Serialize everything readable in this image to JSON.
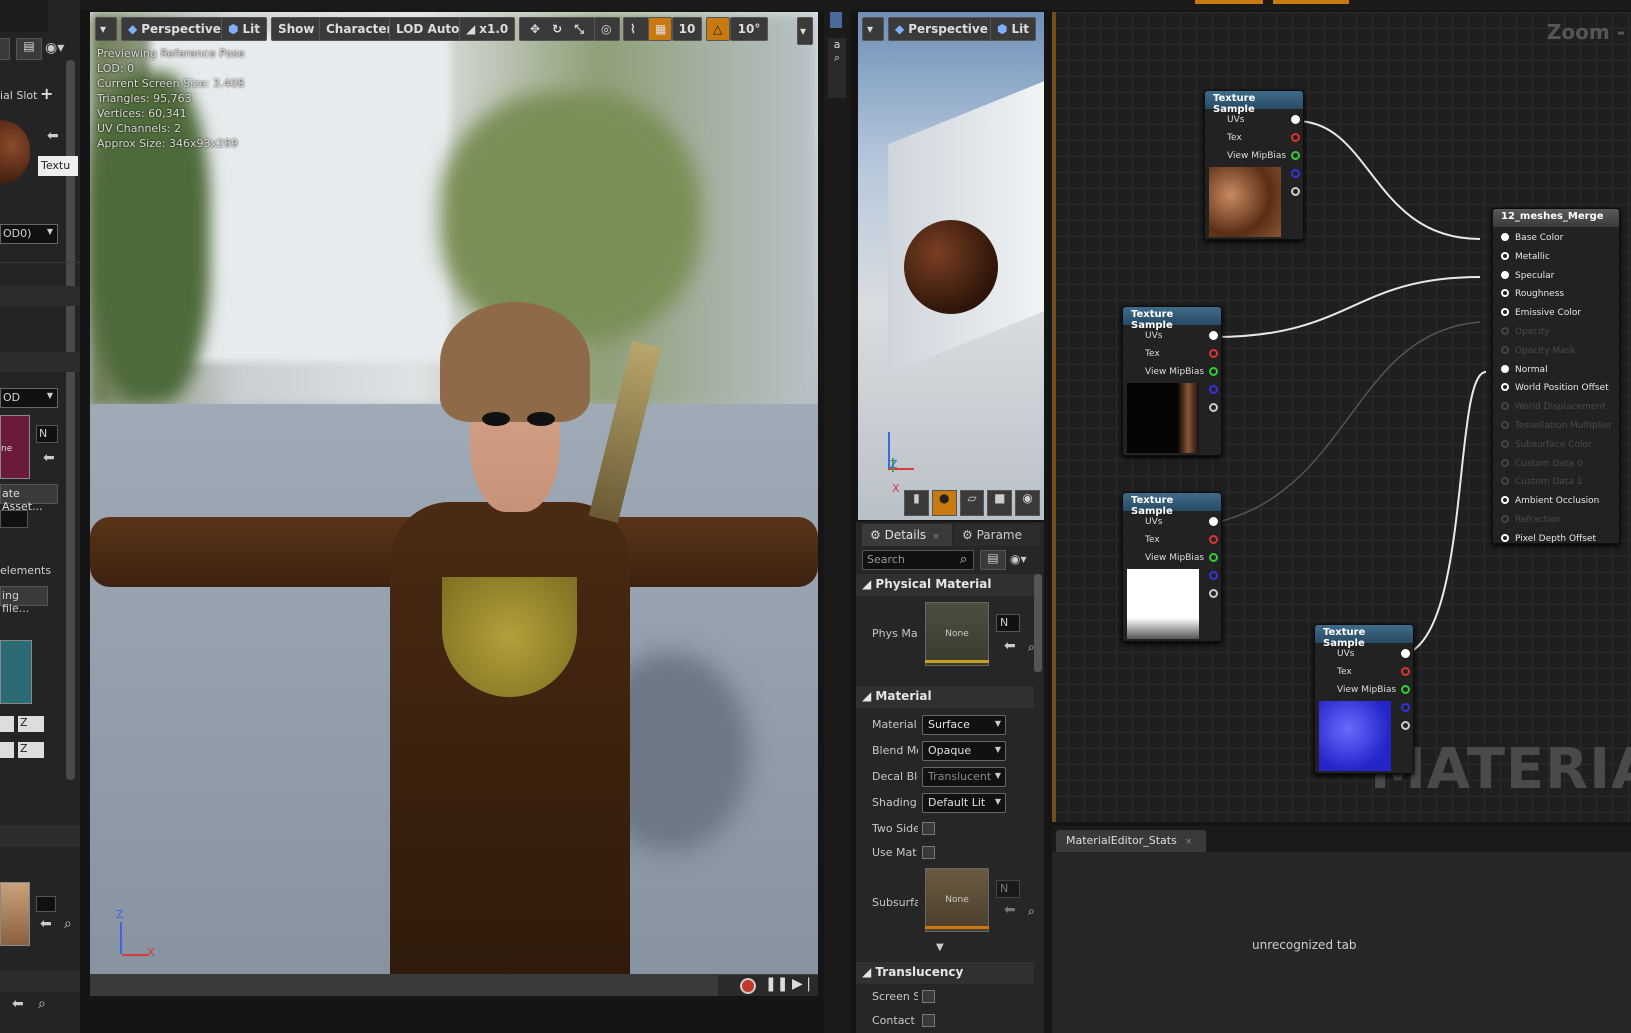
{
  "left_panel": {
    "material_slot_label": "ial Slot",
    "texture_label": "Textu",
    "lod_combo": "OD0)",
    "lod_combo2": "OD",
    "swatch_label": "ne",
    "n_label": "N",
    "create_asset": "ate Asset...",
    "elements_label": "elements",
    "ing_file": "ing file...",
    "z1": "Z",
    "z2": "Z"
  },
  "viewport": {
    "toolbar": {
      "perspective": "Perspective",
      "lit": "Lit",
      "show": "Show",
      "character": "Character",
      "lod": "LOD Auto",
      "speed": "x1.0",
      "grid_snap": "10",
      "angle_snap": "10°"
    },
    "stats": [
      "Previewing Reference Pose",
      "LOD: 0",
      "Current Screen Size: 3.408",
      "Triangles: 95,763",
      "Vertices: 60,341",
      "UV Channels: 2",
      "Approx Size: 346x93x289"
    ]
  },
  "preview": {
    "toolbar": {
      "perspective": "Perspective",
      "lit": "Lit"
    },
    "axis_z": "Z",
    "axis_x": "X"
  },
  "details": {
    "tabs": [
      "Details",
      "Parame"
    ],
    "search_placeholder": "Search",
    "sections": {
      "physical_material": "Physical Material",
      "material": "Material",
      "translucency": "Translucency"
    },
    "phys_mat_label": "Phys Ma",
    "none": "None",
    "n_combo": "N",
    "props": [
      {
        "label": "Material",
        "value": "Surface"
      },
      {
        "label": "Blend Mo",
        "value": "Opaque"
      },
      {
        "label": "Decal Ble",
        "value": "Translucent"
      },
      {
        "label": "Shading",
        "value": "Default Lit"
      }
    ],
    "checks": [
      "Two Side",
      "Use Mat"
    ],
    "subsurface_label": "Subsurfa",
    "translucency_props": [
      "Screen S",
      "Contact"
    ]
  },
  "graph": {
    "zoom_label": "Zoom -",
    "watermark": "MATERIAL",
    "texture_node_title": "Texture Sample",
    "texture_pins": [
      "UVs",
      "Tex",
      "View MipBias"
    ],
    "result_node": {
      "title": "12_meshes_Merge",
      "inputs": [
        {
          "label": "Base Color",
          "active": true
        },
        {
          "label": "Metallic",
          "active": true
        },
        {
          "label": "Specular",
          "active": true
        },
        {
          "label": "Roughness",
          "active": true
        },
        {
          "label": "Emissive Color",
          "active": true
        },
        {
          "label": "Opacity",
          "active": false
        },
        {
          "label": "Opacity Mask",
          "active": false
        },
        {
          "label": "Normal",
          "active": true
        },
        {
          "label": "World Position Offset",
          "active": true
        },
        {
          "label": "World Displacement",
          "active": false
        },
        {
          "label": "Tessellation Multiplier",
          "active": false
        },
        {
          "label": "Subsurface Color",
          "active": false
        },
        {
          "label": "Custom Data 0",
          "active": false
        },
        {
          "label": "Custom Data 1",
          "active": false
        },
        {
          "label": "Ambient Occlusion",
          "active": true
        },
        {
          "label": "Refraction",
          "active": false
        },
        {
          "label": "Pixel Depth Offset",
          "active": true
        }
      ]
    }
  },
  "stats_panel": {
    "tab": "MaterialEditor_Stats",
    "message": "unrecognized tab"
  },
  "colors": {
    "accent": "#ffb20f",
    "node_header": "#2f5a78",
    "graph_bg": "#1f1f1f"
  }
}
